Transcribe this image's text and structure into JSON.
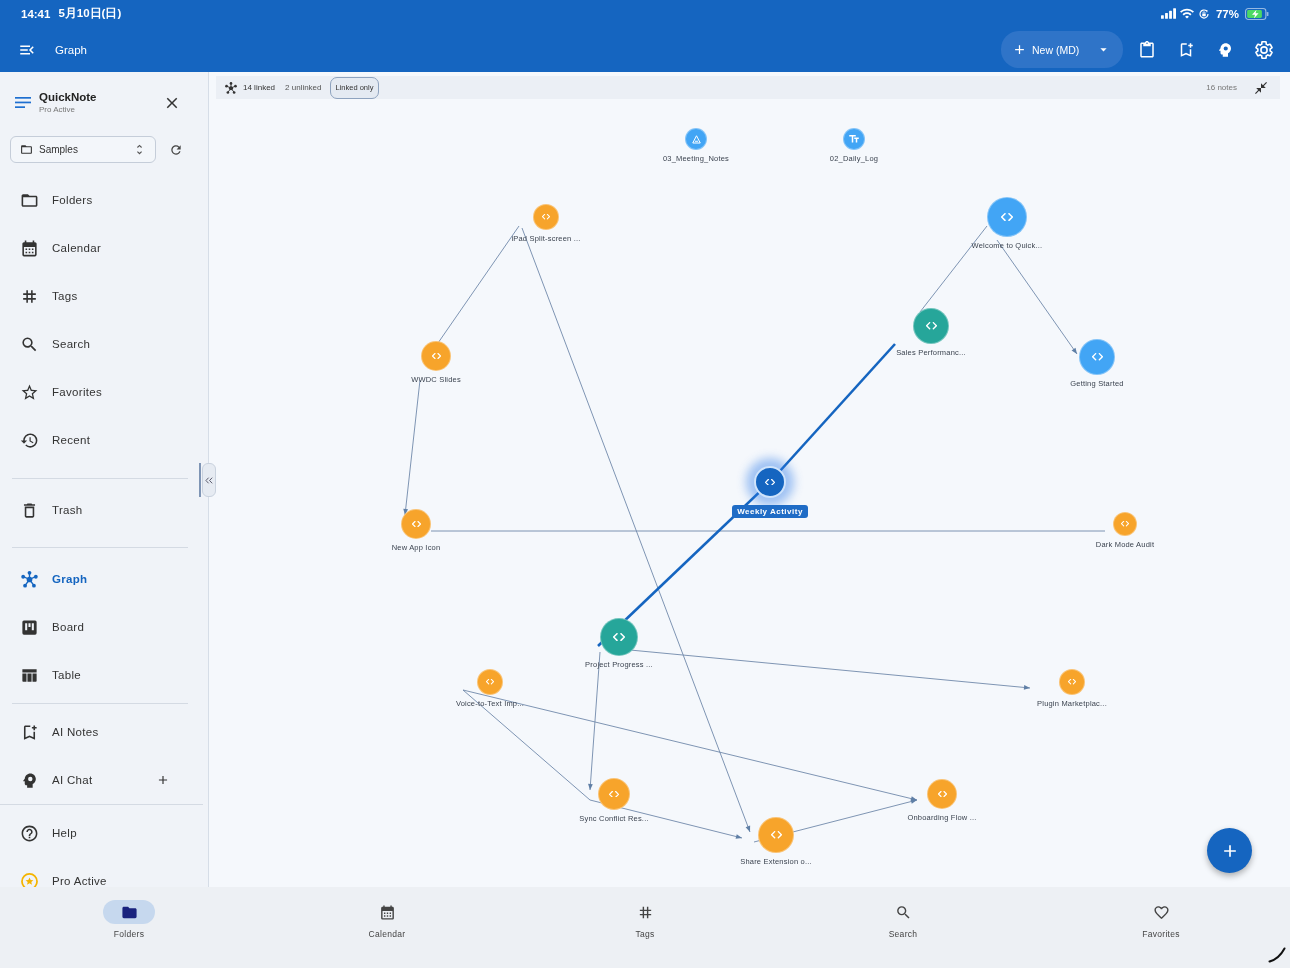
{
  "status_bar": {
    "time": "14:41",
    "date": "5月10日(日)",
    "battery": "77%"
  },
  "app_bar": {
    "title": "Graph",
    "new_button": "New (MD)"
  },
  "sidebar": {
    "app_name": "QuickNote",
    "plan": "Pro Active",
    "folder_picker": "Samples",
    "groups": [
      [
        {
          "label": "Folders",
          "selected": false,
          "add_button": false
        },
        {
          "label": "Calendar",
          "selected": false,
          "add_button": false
        },
        {
          "label": "Tags",
          "selected": false,
          "add_button": false
        },
        {
          "label": "Search",
          "selected": false,
          "add_button": false
        },
        {
          "label": "Favorites",
          "selected": false,
          "add_button": false
        },
        {
          "label": "Recent",
          "selected": false,
          "add_button": false
        }
      ],
      [
        {
          "label": "Trash",
          "selected": false,
          "add_button": false
        }
      ],
      [
        {
          "label": "Graph",
          "selected": true,
          "add_button": false
        },
        {
          "label": "Board",
          "selected": false,
          "add_button": false
        },
        {
          "label": "Table",
          "selected": false,
          "add_button": false
        }
      ],
      [
        {
          "label": "AI Notes",
          "selected": false,
          "add_button": false
        },
        {
          "label": "AI Chat",
          "selected": false,
          "add_button": true
        }
      ],
      [
        {
          "label": "Help",
          "selected": false,
          "add_button": false
        },
        {
          "label": "Pro Active",
          "selected": false,
          "add_button": false
        }
      ]
    ]
  },
  "graph": {
    "toolbar": {
      "linked": "14 linked",
      "unlinked": "2 unlinked",
      "filter_chip": "Linked only",
      "note_count": "16 notes"
    },
    "nodes": [
      {
        "label": "03_Meeting_Notes",
        "kind": "triangle",
        "color": "#42a5f5",
        "selected": false
      },
      {
        "label": "02_Daily_Log",
        "kind": "text",
        "color": "#42a5f5",
        "selected": false
      },
      {
        "label": "iPad Split-screen ...",
        "kind": "code",
        "color": "#f7a42b",
        "selected": false
      },
      {
        "label": "Welcome to Quick...",
        "kind": "code",
        "color": "#42a5f5",
        "selected": false
      },
      {
        "label": "Sales Performanc...",
        "kind": "code",
        "color": "#26a69a",
        "selected": false
      },
      {
        "label": "WWDC Slides",
        "kind": "code",
        "color": "#f7a42b",
        "selected": false
      },
      {
        "label": "Getting Started",
        "kind": "code",
        "color": "#42a5f5",
        "selected": false
      },
      {
        "label": "Weekly Activity",
        "kind": "code",
        "color": "#1565c0",
        "selected": true
      },
      {
        "label": "New App Icon",
        "kind": "code",
        "color": "#f7a42b",
        "selected": false
      },
      {
        "label": "Dark Mode Audit",
        "kind": "code",
        "color": "#f7a42b",
        "selected": false
      },
      {
        "label": "Project Progress ...",
        "kind": "code",
        "color": "#26a69a",
        "selected": false
      },
      {
        "label": "Voice-to-Text Imp...",
        "kind": "code",
        "color": "#f7a42b",
        "selected": false
      },
      {
        "label": "Plugin Marketplac...",
        "kind": "code",
        "color": "#f7a42b",
        "selected": false
      },
      {
        "label": "Sync Conflict Res...",
        "kind": "code",
        "color": "#f7a42b",
        "selected": false
      },
      {
        "label": "Onboarding Flow ...",
        "kind": "code",
        "color": "#f7a42b",
        "selected": false
      },
      {
        "label": "Share Extension o...",
        "kind": "code",
        "color": "#f7a42b",
        "selected": false
      }
    ]
  },
  "bottom_nav": [
    {
      "label": "Folders",
      "selected": true
    },
    {
      "label": "Calendar",
      "selected": false
    },
    {
      "label": "Tags",
      "selected": false
    },
    {
      "label": "Search",
      "selected": false
    },
    {
      "label": "Favorites",
      "selected": false
    }
  ]
}
